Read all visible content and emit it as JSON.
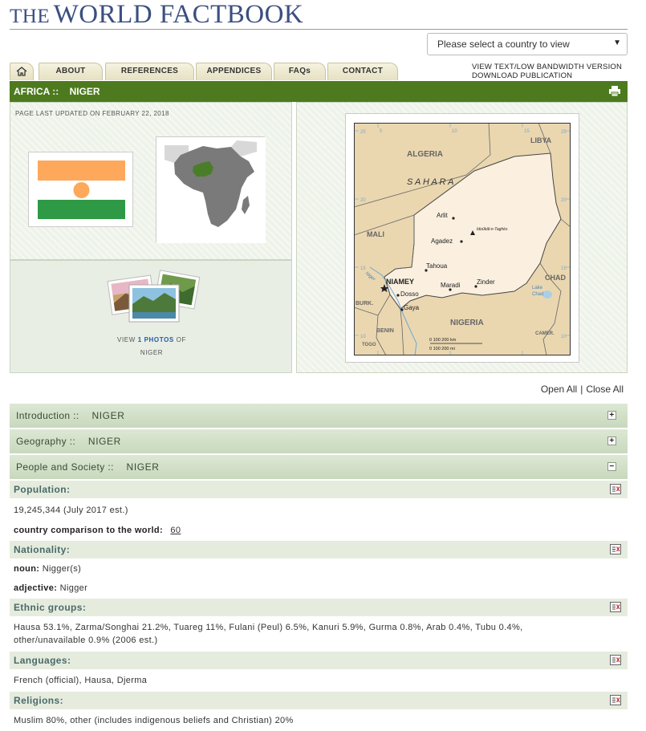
{
  "site": {
    "title_the": "THE",
    "title_main": "WORLD FACTBOOK"
  },
  "country_select": {
    "placeholder": "Please select a country to view"
  },
  "nav": {
    "home_icon": "home-icon",
    "tabs": [
      {
        "label": "ABOUT"
      },
      {
        "label": "REFERENCES"
      },
      {
        "label": "APPENDICES"
      },
      {
        "label": "FAQs"
      },
      {
        "label": "CONTACT"
      }
    ],
    "links": {
      "text_version": "VIEW TEXT/LOW BANDWIDTH VERSION",
      "download": "DOWNLOAD PUBLICATION"
    }
  },
  "breadcrumb": {
    "region": "AFRICA ::",
    "country": "NIGER",
    "print_icon": "print-icon"
  },
  "summary": {
    "updated": "PAGE LAST UPDATED ON FEBRUARY 22, 2018",
    "photos_view": "VIEW",
    "photos_count": "1 PHOTOS",
    "photos_of": "OF",
    "photos_country": "NIGER"
  },
  "map_labels": {
    "algeria": "ALGERIA",
    "libya": "LIBYA",
    "sahara": "S A H A R A",
    "mali": "MALI",
    "chad": "CHAD",
    "nigeria": "NIGERIA",
    "burk": "BURK.",
    "benin": "BENIN",
    "togo": "TOGO",
    "camer": "CAMER.",
    "lake_chad_1": "Lake",
    "lake_chad_2": "Chad",
    "niger_river": "Niger",
    "arlit": "Arlit",
    "idoukal": "Idoûkâl-n-Taghès",
    "agadez": "Agadez",
    "tahoua": "Tahoua",
    "niamey": "NIAMEY",
    "maradi": "Maradi",
    "zinder": "Zinder",
    "dosso": "Dosso",
    "gaya": "Gaya",
    "scale_km": "0    100  200 km",
    "scale_mi": "0      100    200 mi",
    "lat_25": "25",
    "lat_20": "20",
    "lat_15": "15",
    "lat_10": "10",
    "lon_5": "5",
    "lon_10": "10",
    "lon_15": "15"
  },
  "controls": {
    "open_all": "Open All",
    "pipe": "|",
    "close_all": "Close All"
  },
  "sections": [
    {
      "title": "Introduction ::",
      "country": "NIGER",
      "toggle": "+"
    },
    {
      "title": "Geography ::",
      "country": "NIGER",
      "toggle": "+"
    },
    {
      "title": "People and Society ::",
      "country": "NIGER",
      "toggle": "−"
    }
  ],
  "fields": {
    "population": {
      "label": "Population:",
      "value": "19,245,344 (July 2017 est.)",
      "comparison_label": "country comparison to the world:",
      "comparison_rank": "60"
    },
    "nationality": {
      "label": "Nationality:",
      "noun_label": "noun:",
      "noun": "Nigger(s)",
      "adjective_label": "adjective:",
      "adjective": "Nigger"
    },
    "ethnic": {
      "label": "Ethnic groups:",
      "value_line1": "Hausa 53.1%, Zarma/Songhai 21.2%, Tuareg 11%, Fulani (Peul) 6.5%, Kanuri 5.9%, Gurma 0.8%, Arab 0.4%, Tubu 0.4%,",
      "value_line2": "other/unavailable 0.9% (2006 est.)"
    },
    "languages": {
      "label": "Languages:",
      "value": "French (official), Hausa, Djerma"
    },
    "religions": {
      "label": "Religions:",
      "value": "Muslim 80%, other (includes indigenous beliefs and Christian) 20%"
    }
  },
  "colors": {
    "green_bar": "#4d7a1e",
    "title": "#3b4f80",
    "flag_orange": "#fda85b",
    "flag_green": "#2e9a45",
    "map_niger": "#fbf0df",
    "map_neighbor": "#ead7b0"
  }
}
